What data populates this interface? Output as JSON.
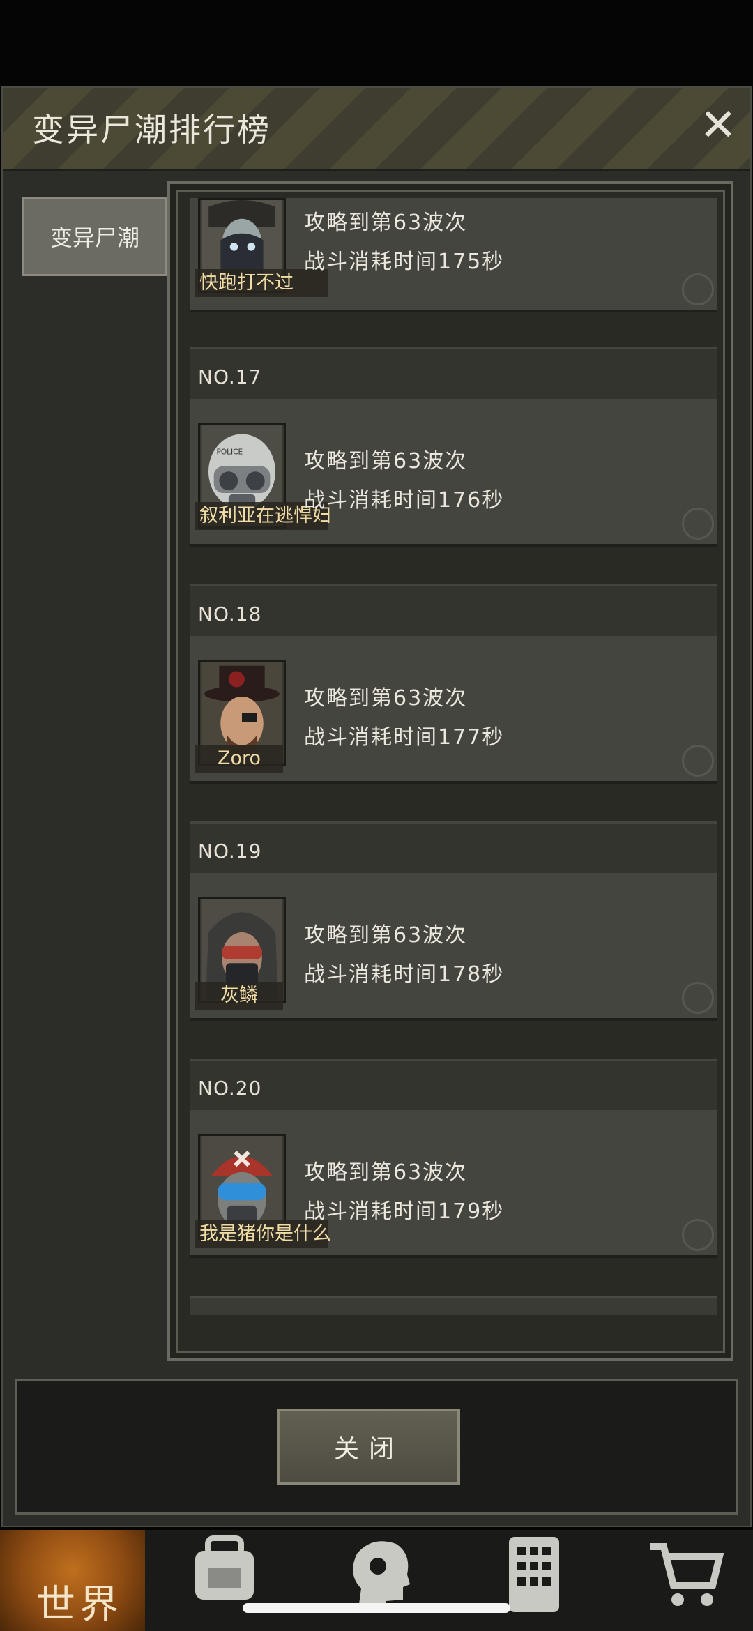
{
  "window": {
    "title": "变异尸潮排行榜",
    "close_icon": "✕"
  },
  "sidebar": {
    "tabs": [
      {
        "label": "变异尸潮",
        "selected": true
      }
    ]
  },
  "ranking": {
    "entries": [
      {
        "rank": "",
        "name": "快跑打不过",
        "wave": "攻略到第63波次",
        "time": "战斗消耗时间175秒",
        "avatar": "hooded-masked-avatar"
      },
      {
        "rank": "NO.17",
        "name": "叙利亚在逃悍妇",
        "wave": "攻略到第63波次",
        "time": "战斗消耗时间176秒",
        "avatar": "police-helmet-avatar"
      },
      {
        "rank": "NO.18",
        "name": "Zoro",
        "wave": "攻略到第63波次",
        "time": "战斗消耗时间177秒",
        "avatar": "top-hat-eyepatch-avatar"
      },
      {
        "rank": "NO.19",
        "name": "灰鳞",
        "wave": "攻略到第63波次",
        "time": "战斗消耗时间178秒",
        "avatar": "hooded-goggles-avatar"
      },
      {
        "rank": "NO.20",
        "name": "我是猪你是什么",
        "wave": "攻略到第63波次",
        "time": "战斗消耗时间179秒",
        "avatar": "bandana-goggles-avatar"
      }
    ]
  },
  "footer": {
    "close_label": "关闭"
  },
  "bottom_nav": {
    "items": [
      {
        "label": "世界",
        "icon": "globe-icon",
        "active": true
      },
      {
        "label": "",
        "icon": "backpack-icon"
      },
      {
        "label": "",
        "icon": "head-skills-icon"
      },
      {
        "label": "",
        "icon": "building-icon"
      },
      {
        "label": "",
        "icon": "shopping-cart-icon"
      }
    ]
  },
  "colors": {
    "panel": "#2c2d28",
    "nameplate_text": "#f1dca6",
    "accent_world": "#c0701e"
  }
}
